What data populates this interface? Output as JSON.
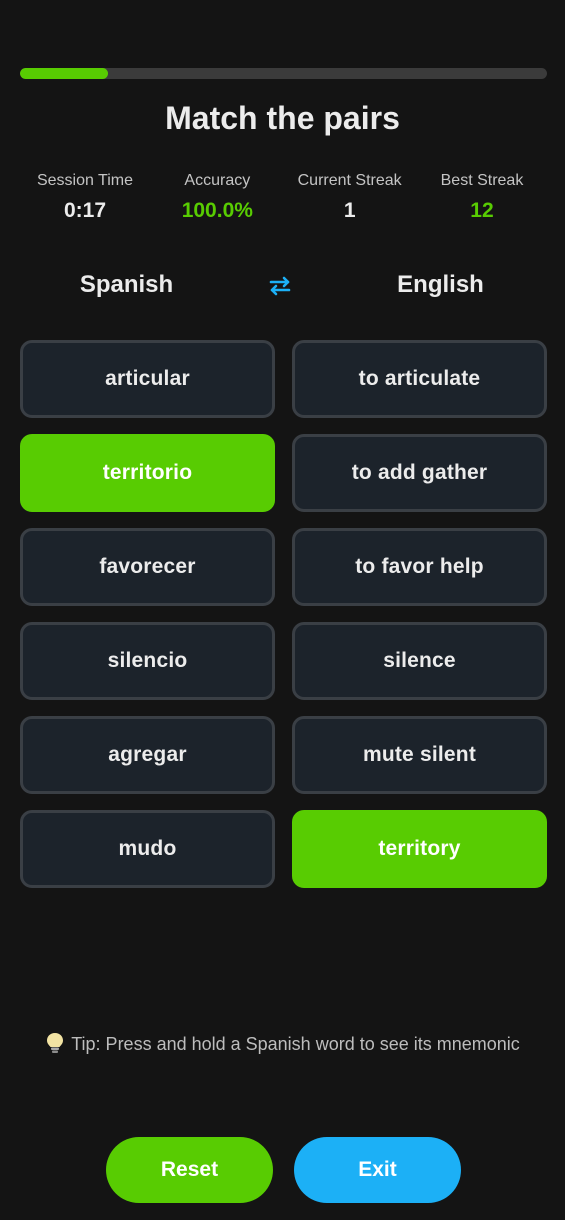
{
  "progress": {
    "fraction": 0.167
  },
  "header": {
    "title": "Match the pairs"
  },
  "stats": [
    {
      "label": "Session Time",
      "value": "0:17",
      "highlight": false
    },
    {
      "label": "Accuracy",
      "value": "100.0%",
      "highlight": true
    },
    {
      "label": "Current Streak",
      "value": "1",
      "highlight": false
    },
    {
      "label": "Best Streak",
      "value": "12",
      "highlight": true
    }
  ],
  "languages": {
    "source": "Spanish",
    "target": "English",
    "swap_icon": "swap-arrows-icon"
  },
  "pairs": {
    "spanish": [
      {
        "text": "articular",
        "selected": false
      },
      {
        "text": "territorio",
        "selected": true
      },
      {
        "text": "favorecer",
        "selected": false
      },
      {
        "text": "silencio",
        "selected": false
      },
      {
        "text": "agregar",
        "selected": false
      },
      {
        "text": "mudo",
        "selected": false
      }
    ],
    "english": [
      {
        "text": "to articulate",
        "selected": false
      },
      {
        "text": "to add gather",
        "selected": false
      },
      {
        "text": "to favor help",
        "selected": false
      },
      {
        "text": "silence",
        "selected": false
      },
      {
        "text": "mute silent",
        "selected": false
      },
      {
        "text": "territory",
        "selected": true
      }
    ]
  },
  "tip": {
    "icon": "lightbulb-icon",
    "text": "Tip: Press and hold a Spanish word to see its mnemonic"
  },
  "buttons": {
    "reset": "Reset",
    "exit": "Exit"
  },
  "colors": {
    "accent_green": "#58cc02",
    "accent_blue": "#1cb0f6",
    "background": "#141414",
    "card": "#1c232b",
    "card_border": "#3a3f45"
  }
}
